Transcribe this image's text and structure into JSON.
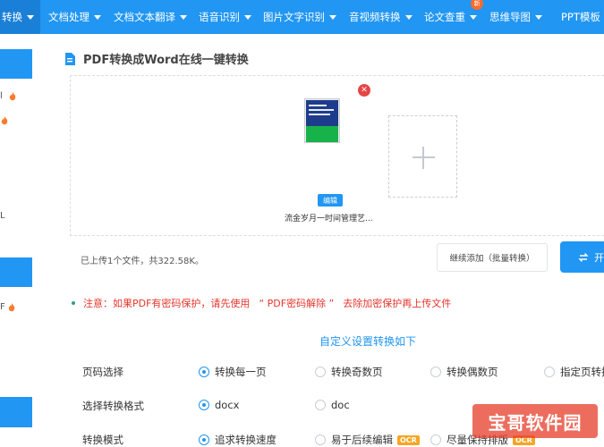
{
  "nav": {
    "items": [
      {
        "label": "转换",
        "active": true
      },
      {
        "label": "文档处理"
      },
      {
        "label": "文档文本翻译"
      },
      {
        "label": "语音识别"
      },
      {
        "label": "图片文字识别"
      },
      {
        "label": "音视频转换"
      },
      {
        "label": "论文查重"
      },
      {
        "label": "思维导图"
      },
      {
        "label": "PPT模板"
      }
    ],
    "new_badge": "新"
  },
  "sidebar": {
    "fragment_1": "l",
    "fragment_2": "L",
    "fragment_3": "F"
  },
  "page_title": "PDF转换成Word在线一键转换",
  "upload": {
    "file_name": "流金岁月一时间管理艺...",
    "edit_label": "编辑",
    "status": "已上传1个文件，共322.58K。",
    "continue_label": "继续添加（批量转换）",
    "start_label": "开"
  },
  "notice": {
    "prefix": "注意：如果PDF有密码保护，请先使用",
    "link": "“ PDF密码解除 ”",
    "suffix": "去除加密保护再上传文件"
  },
  "settings_heading": "自定义设置转换如下",
  "options": {
    "page_select": {
      "label": "页码选择",
      "choices": [
        "转换每一页",
        "转换奇数页",
        "转换偶数页",
        "指定页转换"
      ],
      "selected": 0
    },
    "format": {
      "label": "选择转换格式",
      "choices": [
        "docx",
        "doc"
      ],
      "selected": 0
    },
    "mode": {
      "label": "转换模式",
      "choices": [
        "追求转换速度",
        "易于后续编辑",
        "尽量保持排版"
      ],
      "badge": "OCR",
      "selected": 0
    }
  },
  "watermark": "宝哥软件园",
  "colors": {
    "primary": "#2196f3",
    "notice": "#e6352b",
    "ocr_badge": "#f5a623"
  }
}
